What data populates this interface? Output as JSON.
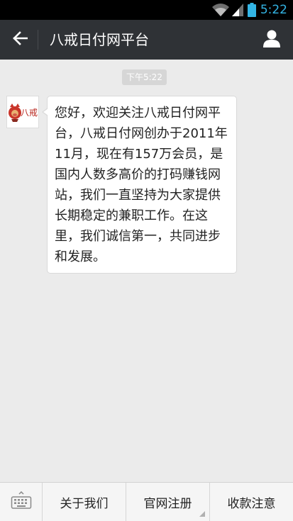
{
  "status_bar": {
    "time": "5:22",
    "time_color": "#33b5e5",
    "icons": [
      "wifi-icon",
      "signal-icon",
      "battery-icon"
    ]
  },
  "header": {
    "title": "八戒日付网平台",
    "back_icon": "back-arrow-icon",
    "profile_icon": "person-icon",
    "background": "#2f3236"
  },
  "chat": {
    "timestamp": "下午5:22",
    "messages": [
      {
        "sender_avatar_text": "八戒",
        "text": "您好，欢迎关注八戒日付网平台，八戒日付网创办于2011年11月，现在有157万会员，是国内人数多高价的打码赚钱网站，我们一直坚持为大家提供长期稳定的兼职工作。在这里，我们诚信第一，共同进步和发展。"
      }
    ]
  },
  "bottom_menu": {
    "keyboard_icon": "keyboard-icon",
    "items": [
      {
        "label": "关于我们"
      },
      {
        "label": "官网注册",
        "has_submenu": true
      },
      {
        "label": "收款注意"
      }
    ]
  }
}
